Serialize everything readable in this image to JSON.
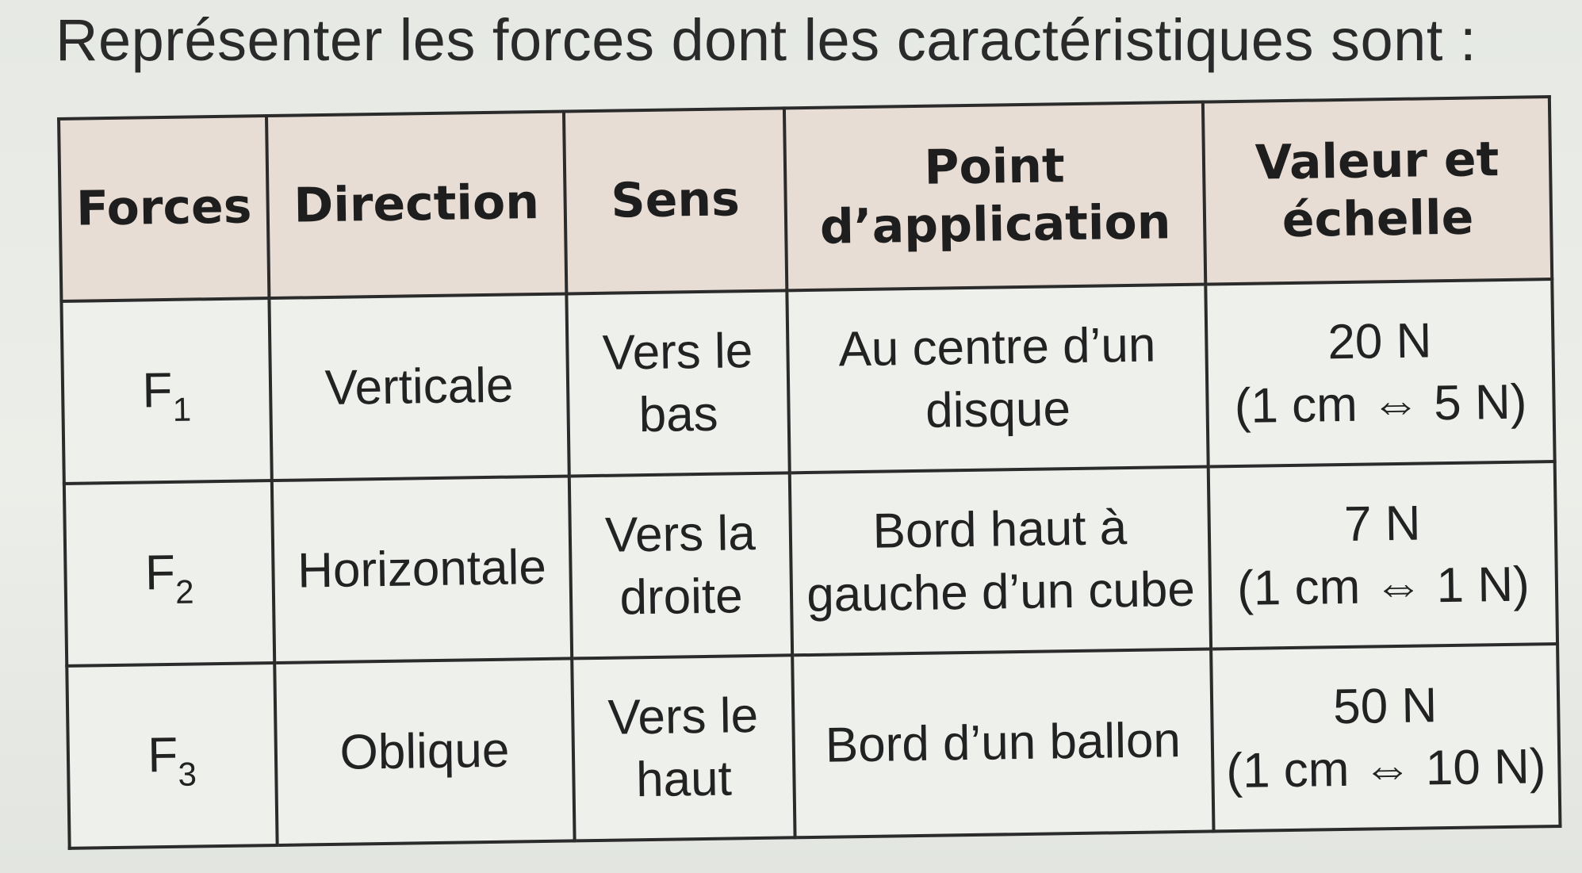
{
  "instruction": "Représenter les forces dont les caractéristiques sont :",
  "table": {
    "headers": {
      "forces": "Forces",
      "direction": "Direction",
      "sens": "Sens",
      "point_line1": "Point",
      "point_line2": "d’application",
      "valeur_line1": "Valeur et",
      "valeur_line2": "échelle"
    },
    "rows": [
      {
        "force_letter": "F",
        "force_index": "1",
        "direction": "Verticale",
        "sens_line1": "Vers le",
        "sens_line2": "bas",
        "point_line1": "Au centre d’un",
        "point_line2": "disque",
        "valeur": "20 N",
        "echelle": "(1 cm ⇔ 5 N)"
      },
      {
        "force_letter": "F",
        "force_index": "2",
        "direction": "Horizontale",
        "sens_line1": "Vers la",
        "sens_line2": "droite",
        "point_line1": "Bord haut à",
        "point_line2": "gauche d’un cube",
        "valeur": "7 N",
        "echelle": "(1 cm ⇔ 1 N)"
      },
      {
        "force_letter": "F",
        "force_index": "3",
        "direction": "Oblique",
        "sens_line1": "Vers le",
        "sens_line2": "haut",
        "point_line1": "Bord d’un ballon",
        "point_line2": "",
        "valeur": "50 N",
        "echelle": "(1 cm ⇔ 10 N)"
      }
    ]
  }
}
